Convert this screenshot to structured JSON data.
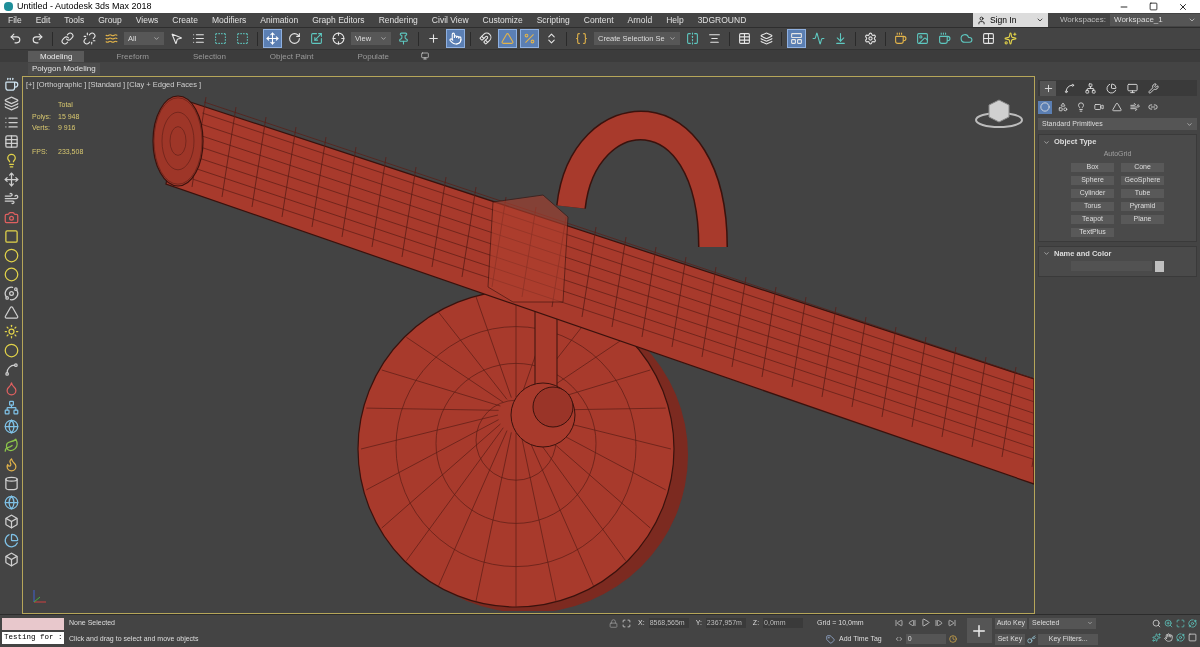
{
  "window": {
    "title": "Untitled - Autodesk 3ds Max 2018"
  },
  "menu": [
    "File",
    "Edit",
    "Tools",
    "Group",
    "Views",
    "Create",
    "Modifiers",
    "Animation",
    "Graph Editors",
    "Rendering",
    "Civil View",
    "Customize",
    "Scripting",
    "Content",
    "Arnold",
    "Help",
    "3DGROUND"
  ],
  "account": {
    "sign_in": "Sign In",
    "workspaces_label": "Workspaces:",
    "workspace": "Workspace_1"
  },
  "toolbar": [
    {
      "kind": "tool",
      "active": false
    },
    {
      "kind": "tool",
      "active": false
    },
    {
      "kind": "sep"
    },
    {
      "kind": "tool",
      "active": false
    },
    {
      "kind": "tool",
      "active": false
    },
    {
      "kind": "tool",
      "active": false
    },
    {
      "kind": "dropdown",
      "text": "All"
    },
    {
      "kind": "tool",
      "active": false
    },
    {
      "kind": "tool",
      "active": false
    },
    {
      "kind": "tool",
      "active": false
    },
    {
      "kind": "tool",
      "active": false
    },
    {
      "kind": "sep"
    },
    {
      "kind": "tool",
      "active": true
    },
    {
      "kind": "tool",
      "active": false
    },
    {
      "kind": "tool",
      "active": false
    },
    {
      "kind": "tool",
      "active": false
    },
    {
      "kind": "dropdown",
      "text": "View"
    },
    {
      "kind": "tool",
      "active": false
    },
    {
      "kind": "sep"
    },
    {
      "kind": "tool",
      "active": false
    },
    {
      "kind": "tool",
      "active": true
    },
    {
      "kind": "sep"
    },
    {
      "kind": "tool",
      "active": false
    },
    {
      "kind": "tool",
      "active": true
    },
    {
      "kind": "tool",
      "active": true
    },
    {
      "kind": "tool",
      "active": false
    },
    {
      "kind": "sep"
    },
    {
      "kind": "tool",
      "active": false
    },
    {
      "kind": "dropdown",
      "text": "Create Selection Se"
    },
    {
      "kind": "tool",
      "active": false
    },
    {
      "kind": "tool",
      "active": false
    },
    {
      "kind": "sep"
    },
    {
      "kind": "tool",
      "active": false
    },
    {
      "kind": "tool",
      "active": false
    },
    {
      "kind": "sep"
    },
    {
      "kind": "tool",
      "active": true
    },
    {
      "kind": "tool",
      "active": false
    },
    {
      "kind": "tool",
      "active": false
    },
    {
      "kind": "sep"
    },
    {
      "kind": "tool",
      "active": false
    },
    {
      "kind": "sep"
    },
    {
      "kind": "tool",
      "active": false
    },
    {
      "kind": "tool",
      "active": false
    },
    {
      "kind": "tool",
      "active": false
    },
    {
      "kind": "tool",
      "active": false
    },
    {
      "kind": "tool",
      "active": false
    },
    {
      "kind": "tool",
      "active": false
    }
  ],
  "ribbon": {
    "tabs": [
      {
        "label": "Modeling",
        "selected": true
      },
      {
        "label": "Freeform",
        "selected": false
      },
      {
        "label": "Selection",
        "selected": false
      },
      {
        "label": "Object Paint",
        "selected": false
      },
      {
        "label": "Populate",
        "selected": false
      }
    ],
    "panel": "Polygon Modeling"
  },
  "viewport": {
    "label": "[+] [Orthographic ] [Standard ] [Clay + Edged Faces ]",
    "stats_header": "Total",
    "stats": [
      {
        "label": "Polys:",
        "value": "15 948"
      },
      {
        "label": "Verts:",
        "value": "9 916"
      }
    ],
    "fps_label": "FPS:",
    "fps": "233,508",
    "active": true
  },
  "command_panel": {
    "tabs": [
      {
        "selected": true
      },
      {
        "selected": false
      },
      {
        "selected": false
      },
      {
        "selected": false
      },
      {
        "selected": false
      },
      {
        "selected": false
      }
    ],
    "categories": [
      {
        "selected": true
      },
      {
        "selected": false
      },
      {
        "selected": false
      },
      {
        "selected": false
      },
      {
        "selected": false
      },
      {
        "selected": false
      },
      {
        "selected": false
      }
    ],
    "dropdown": "Standard Primitives",
    "object_type_title": "Object Type",
    "autogrid": {
      "label": "AutoGrid",
      "disabled": true
    },
    "object_types": [
      "Box",
      "Cone",
      "Sphere",
      "GeoSphere",
      "Cylinder",
      "Tube",
      "Torus",
      "Pyramid",
      "Teapot",
      "Plane",
      "TextPlus"
    ],
    "name_and_color_title": "Name and Color"
  },
  "status_bar": {
    "listener": "Testing for :",
    "selection": "None Selected",
    "prompt": "Click and drag to select and move objects",
    "coords": [
      {
        "axis": "X:",
        "value": "8568,565m"
      },
      {
        "axis": "Y:",
        "value": "2367,957m"
      },
      {
        "axis": "Z:",
        "value": "0,0mm"
      }
    ],
    "grid": "Grid = 10,0mm",
    "time_tag": "Add Time Tag",
    "frame": "0",
    "auto_key": "Auto Key",
    "key_mode": "Selected",
    "set_key": "Set Key",
    "key_filters": "Key Filters..."
  }
}
